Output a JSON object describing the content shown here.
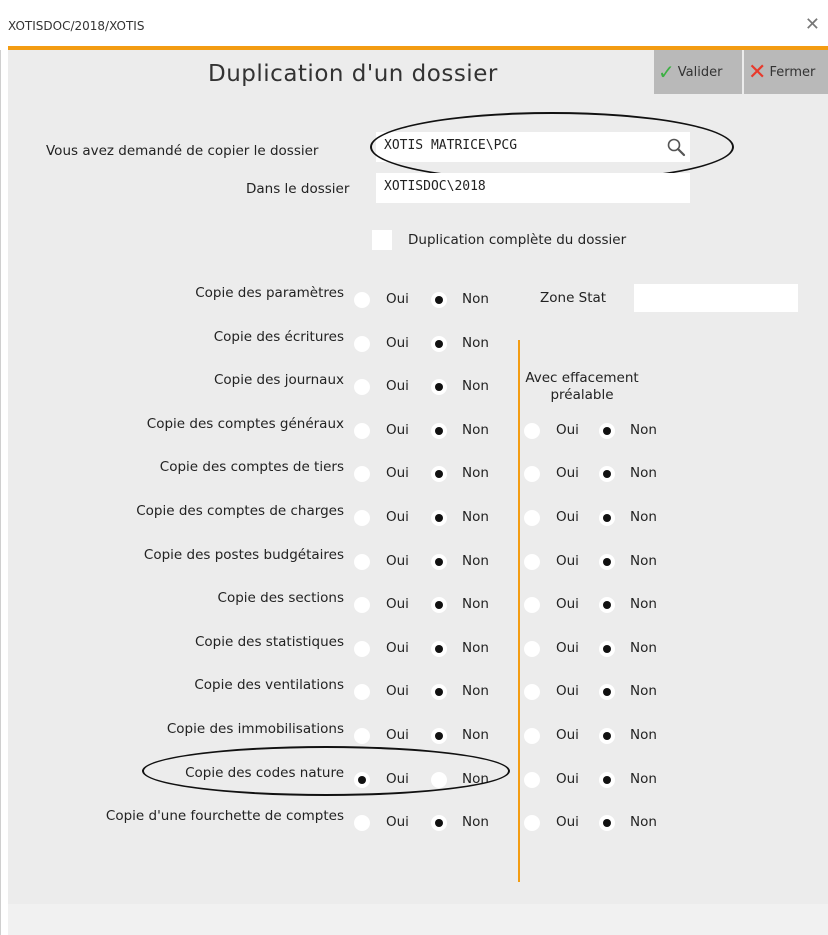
{
  "window": {
    "title": "XOTISDOC/2018/XOTIS",
    "close_glyph": "✕"
  },
  "dialog": {
    "title": "Duplication d'un dossier",
    "valider_label": "Valider",
    "fermer_label": "Fermer",
    "source_label": "Vous avez demandé de copier le dossier",
    "source_value": "XOTIS MATRICE\\PCG",
    "target_label": "Dans le dossier",
    "target_value": "XOTISDOC\\2018",
    "full_copy_label": "Duplication complète du dossier",
    "full_copy_checked": false,
    "zone_stat_label": "Zone Stat",
    "zone_stat_value": "",
    "effacement_label_1": "Avec effacement",
    "effacement_label_2": "préalable",
    "oui": "Oui",
    "non": "Non"
  },
  "rows": [
    {
      "label": "Copie des paramètres",
      "copy": "Non",
      "effacement": null
    },
    {
      "label": "Copie des écritures",
      "copy": "Non",
      "effacement": null
    },
    {
      "label": "Copie des journaux",
      "copy": "Non",
      "effacement": null
    },
    {
      "label": "Copie des comptes généraux",
      "copy": "Non",
      "effacement": "Non"
    },
    {
      "label": "Copie des comptes de tiers",
      "copy": "Non",
      "effacement": "Non"
    },
    {
      "label": "Copie des comptes de charges",
      "copy": "Non",
      "effacement": "Non"
    },
    {
      "label": "Copie des postes budgétaires",
      "copy": "Non",
      "effacement": "Non"
    },
    {
      "label": "Copie des sections",
      "copy": "Non",
      "effacement": "Non"
    },
    {
      "label": "Copie des statistiques",
      "copy": "Non",
      "effacement": "Non"
    },
    {
      "label": "Copie des ventilations",
      "copy": "Non",
      "effacement": "Non"
    },
    {
      "label": "Copie des immobilisations",
      "copy": "Non",
      "effacement": "Non"
    },
    {
      "label": "Copie des codes nature",
      "copy": "Oui",
      "effacement": "Non"
    },
    {
      "label": "Copie d'une fourchette de comptes",
      "copy": "Non",
      "effacement": "Non"
    }
  ]
}
